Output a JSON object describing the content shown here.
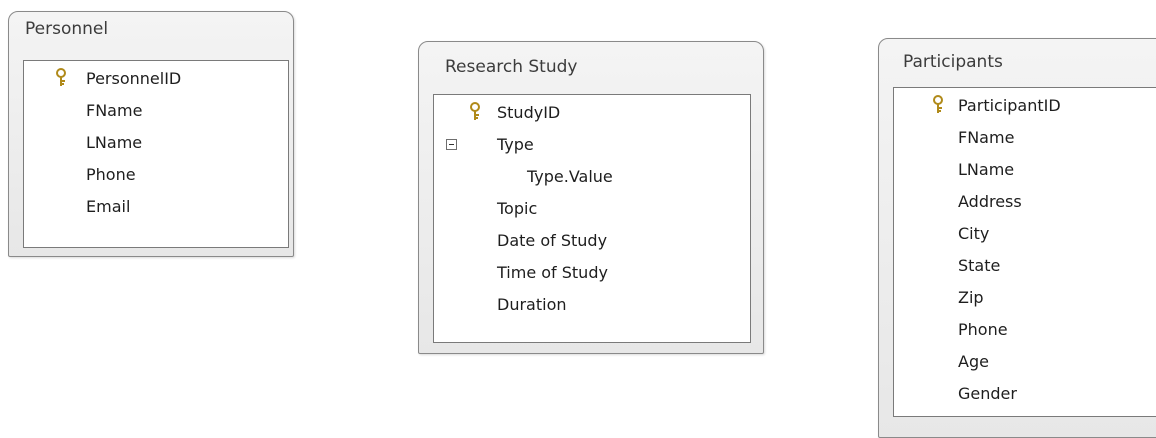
{
  "personnel": {
    "title": "Personnel",
    "fields": [
      "PersonnelID",
      "FName",
      "LName",
      "Phone",
      "Email"
    ]
  },
  "research_study": {
    "title": "Research Study",
    "fields": [
      "StudyID",
      "Type",
      "Type.Value",
      "Topic",
      "Date of Study",
      "Time of Study",
      "Duration"
    ]
  },
  "participants": {
    "title": "Participants",
    "fields": [
      "ParticipantID",
      "FName",
      "LName",
      "Address",
      "City",
      "State",
      "Zip",
      "Phone",
      "Age",
      "Gender"
    ]
  },
  "icons": {
    "primary_key": "key-icon",
    "multivalue_collapse": "minus-box-icon"
  },
  "colors": {
    "key_gold": "#c9a227"
  }
}
